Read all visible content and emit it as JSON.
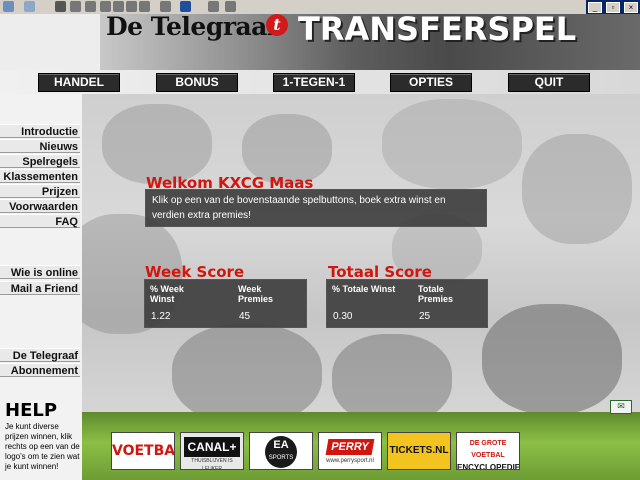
{
  "header": {
    "logo_text": "De Telegraaf",
    "logo_badge": "t",
    "title": "TRANSFERSPEL"
  },
  "nav": [
    "HANDEL",
    "BONUS",
    "1-TEGEN-1",
    "OPTIES",
    "QUIT"
  ],
  "sidebar": {
    "group1": [
      "Introductie",
      "Nieuws",
      "Spelregels",
      "Klassementen",
      "Prijzen",
      "Voorwaarden",
      "FAQ"
    ],
    "group2": [
      "Wie is online",
      "Mail a Friend"
    ],
    "group3": [
      "De Telegraaf",
      "Abonnement"
    ]
  },
  "welcome": {
    "title": "Welkom KXCG Maas",
    "text": "Klik op een van de bovenstaande spelbuttons, boek extra winst en verdien extra premies!"
  },
  "week_score": {
    "title": "Week Score",
    "col1_header": "% Week Winst",
    "col2_header": "Week Premies",
    "col1_value": "1.22",
    "col2_value": "45"
  },
  "totaal_score": {
    "title": "Totaal Score",
    "col1_header": "% Totale Winst",
    "col2_header": "Totale Premies",
    "col1_value": "0.30",
    "col2_value": "25"
  },
  "help": {
    "title": "HELP",
    "text": "Je kunt diverse prijzen winnen, klik rechts op een van de logo's om te zien wat je kunt winnen!"
  },
  "sponsors": {
    "voetbal": "VOETBAL",
    "canal": "CANAL+",
    "canal_sub": "THUISBLIJVEN IS LEUKER",
    "ea": "EA",
    "ea_sub": "SPORTS",
    "perry": "PERRY",
    "perry_sub": "www.perrysport.nl",
    "tickets": "TICKETS.NL",
    "encyclopedie_top": "DE GROTE VOETBAL",
    "encyclopedie": "ENCYCLOPEDIE"
  },
  "colors": {
    "accent_red": "#d0160f",
    "panel": "#3c3c3c",
    "nav_button": "#2b2b2b",
    "bottom_green": "#8bbf46"
  }
}
